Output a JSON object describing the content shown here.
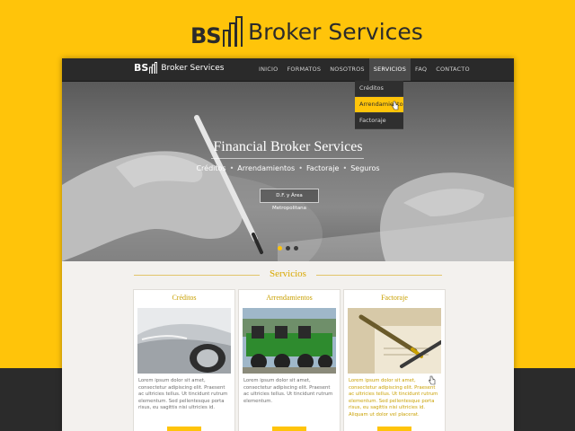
{
  "brand": {
    "logo_text": "BS",
    "name": "Broker Services"
  },
  "site": {
    "logo_text": "BS",
    "name": "Broker Services",
    "nav": [
      {
        "label": "INICIO",
        "active": false
      },
      {
        "label": "FORMATOS",
        "active": false
      },
      {
        "label": "NOSOTROS",
        "active": false
      },
      {
        "label": "SERVICIOS",
        "active": true
      },
      {
        "label": "FAQ",
        "active": false
      },
      {
        "label": "CONTACTO",
        "active": false
      }
    ],
    "dropdown": [
      {
        "label": "Créditos",
        "highlight": false
      },
      {
        "label": "Arrendamiento",
        "highlight": true
      },
      {
        "label": "Factoraje",
        "highlight": false
      }
    ],
    "hero": {
      "title": "Financial Broker Services",
      "links": [
        "Créditos",
        "Arrendamientos",
        "Factoraje",
        "Seguros"
      ],
      "button": "D.F. y Área Metropolitana",
      "slide_count": 3,
      "active_slide": 1
    },
    "section_title": "Servicios",
    "cards": [
      {
        "title": "Créditos",
        "image": "car-image",
        "highlight": false,
        "text": "Lorem ipsum dolor sit amet, consectetur adipiscing elit. Praesent ac ultricies tellus. Ut tincidunt rutrum elementum. Sed pellentesque porta risus, eu sagittis nisi ultricies id."
      },
      {
        "title": "Arrendamientos",
        "image": "tractors-image",
        "highlight": false,
        "text": "Lorem ipsum dolor sit amet, consectetur adipiscing elit. Praesent ac ultricies tellus. Ut tincidunt rutrum elementum."
      },
      {
        "title": "Factoraje",
        "image": "pen-signature-image",
        "highlight": true,
        "text": "Lorem ipsum dolor sit amet, consectetur adipiscing elit. Praesent ac ultricies tellus. Ut tincidunt rutrum elementum. Sed pellentesque porta risus, eu sagittis nisi ultricies id. Aliquam ut dolor vel placerat."
      }
    ]
  },
  "colors": {
    "accent": "#ffc40a",
    "dark": "#2b2b2b",
    "gold_text": "#c9a000"
  }
}
